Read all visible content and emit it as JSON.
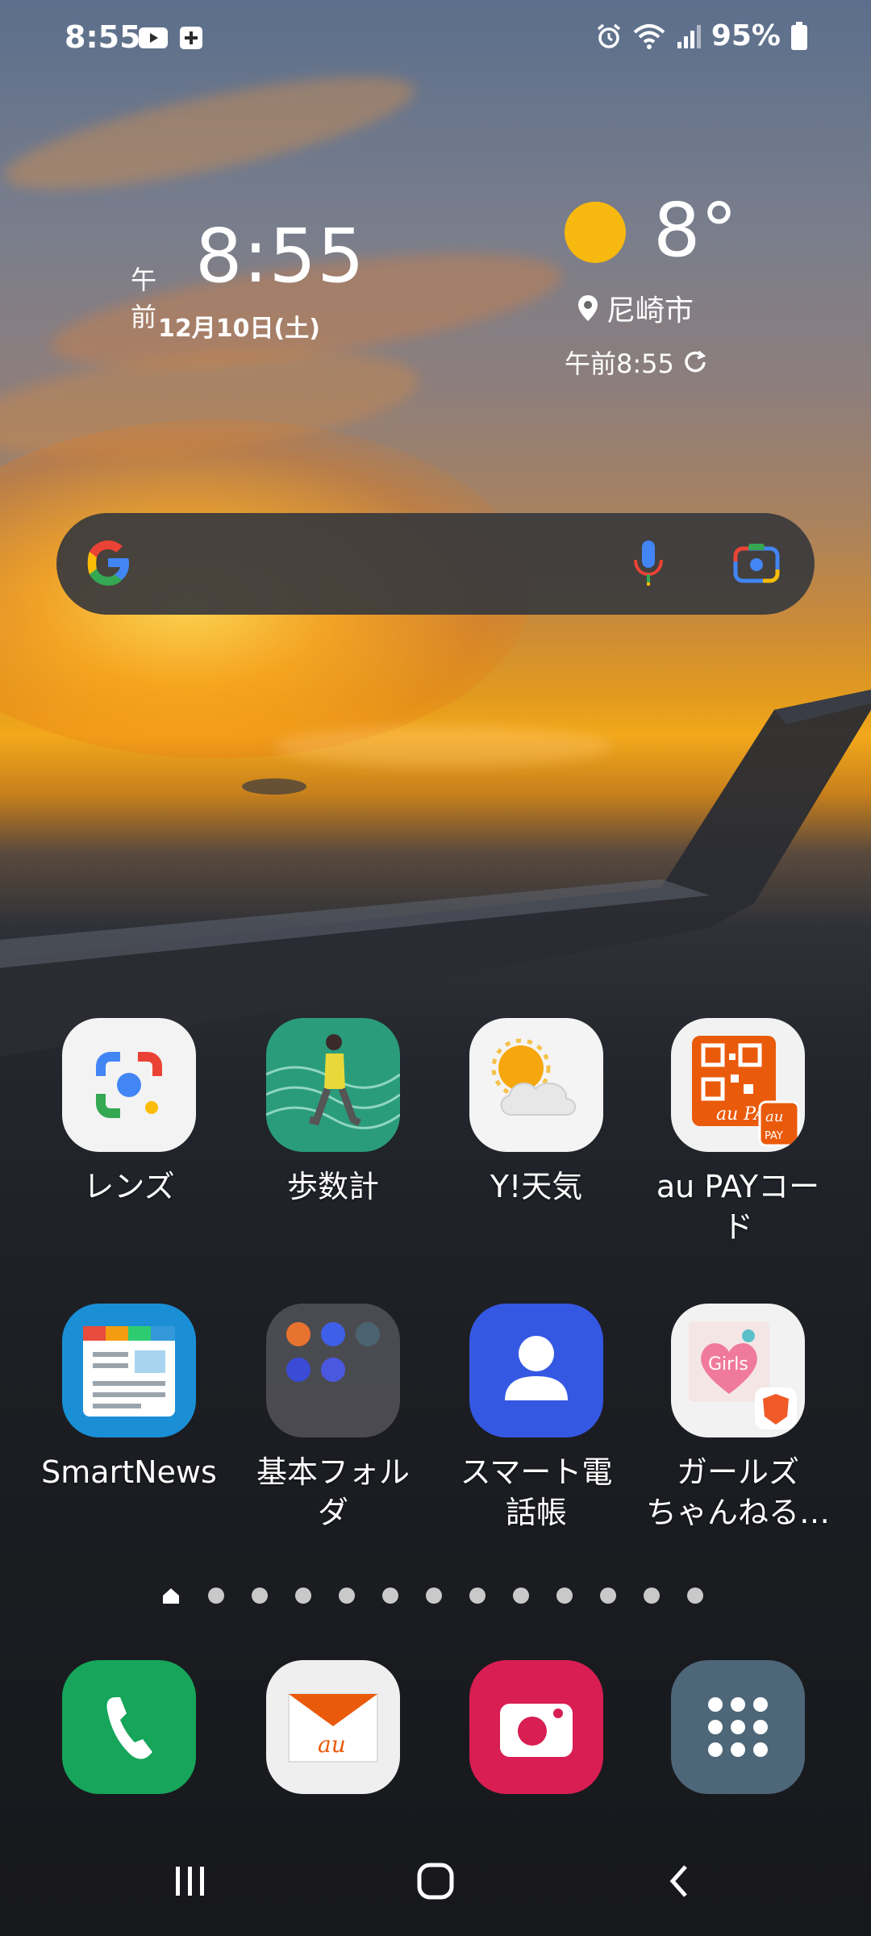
{
  "status_bar": {
    "time": "8:55",
    "battery": "95%",
    "left_icons": [
      "youtube-icon",
      "plus-square-icon"
    ],
    "right_icons": [
      "alarm-icon",
      "wifi-icon",
      "signal-icon",
      "battery-icon"
    ]
  },
  "clock_widget": {
    "ampm": "午前",
    "time": "8:55",
    "date": "12月10日(土)"
  },
  "weather_widget": {
    "temperature": "8°",
    "location": "尼崎市",
    "updated": "午前8:55",
    "condition_icon": "sun-icon"
  },
  "search_bar": {
    "google_icon": "google-g-icon",
    "mic_icon": "mic-icon",
    "lens_icon": "google-lens-camera-icon"
  },
  "apps_row1": [
    {
      "label": "レンズ",
      "icon": "google-lens-icon"
    },
    {
      "label": "歩数計",
      "icon": "pedometer-icon"
    },
    {
      "label": "Y!天気",
      "icon": "yahoo-weather-icon"
    },
    {
      "label": "au PAYコード",
      "label_line1": "au PAYコー",
      "label_line2": "ド",
      "icon": "au-pay-qr-icon"
    }
  ],
  "apps_row2": [
    {
      "label": "SmartNews",
      "icon": "smartnews-icon"
    },
    {
      "label": "基本フォルダ",
      "label_line1": "基本フォル",
      "label_line2": "ダ",
      "icon": "folder-icon"
    },
    {
      "label": "スマート電話帳",
      "label_line1": "スマート電",
      "label_line2": "話帳",
      "icon": "contacts-icon"
    },
    {
      "label": "ガールズちゃんねる…",
      "label_line1": "ガールズ",
      "label_line2": "ちゃんねる…",
      "icon": "girls-channel-icon"
    }
  ],
  "page_indicator": {
    "pages": 13,
    "current": 1
  },
  "dock": [
    {
      "name": "phone",
      "icon": "phone-icon"
    },
    {
      "name": "au-mail",
      "icon": "au-mail-icon"
    },
    {
      "name": "camera",
      "icon": "camera-icon"
    },
    {
      "name": "app-drawer",
      "icon": "apps-grid-icon"
    }
  ],
  "navbar": {
    "recents_icon": "recents-icon",
    "home_icon": "home-icon",
    "back_icon": "back-icon"
  }
}
